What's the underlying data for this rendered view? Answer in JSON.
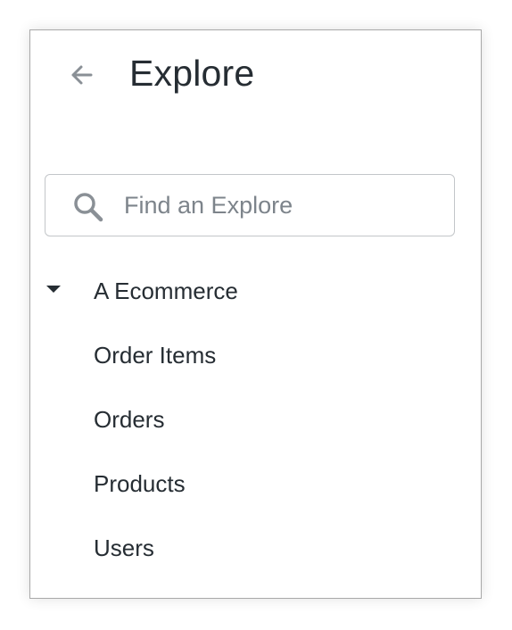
{
  "header": {
    "title": "Explore",
    "back_icon": "arrow-left-icon"
  },
  "search": {
    "placeholder": "Find an Explore",
    "value": "",
    "icon": "search-icon"
  },
  "tree": {
    "group": {
      "label": "A Ecommerce",
      "expanded": true,
      "icon": "caret-down-icon"
    },
    "items": [
      {
        "label": "Order Items"
      },
      {
        "label": "Orders"
      },
      {
        "label": "Products"
      },
      {
        "label": "Users"
      }
    ]
  },
  "colors": {
    "text": "#262d33",
    "placeholder": "#7d848b",
    "icon": "#8a9096",
    "border": "#a8a8a8"
  }
}
